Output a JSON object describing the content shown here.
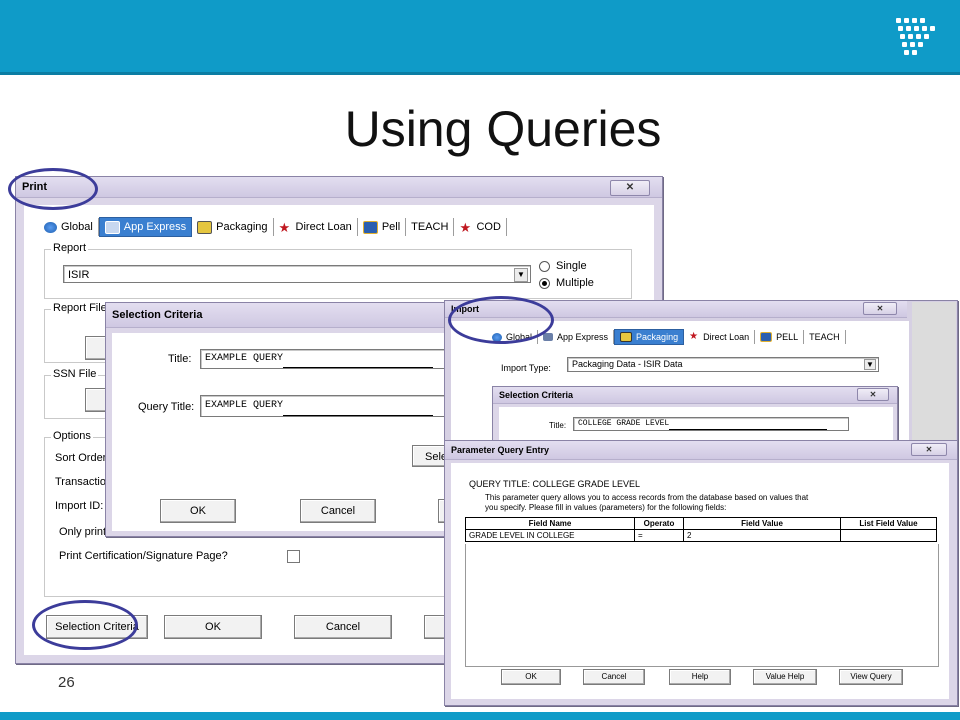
{
  "slide": {
    "title": "Using Queries",
    "page_number": "26"
  },
  "colors": {
    "banner": "#0f9bc8",
    "window_frame": "#dcd6e8",
    "tab_active": "#3a7fd0",
    "highlight_oval": "#3c3c9a"
  },
  "print_window": {
    "title": "Print",
    "close": "✕",
    "tabs": [
      {
        "label": "Global",
        "icon": "globe-icon"
      },
      {
        "label": "App Express",
        "icon": "app-express-icon"
      },
      {
        "label": "Packaging",
        "icon": "packaging-icon"
      },
      {
        "label": "Direct Loan",
        "icon": "star-icon"
      },
      {
        "label": "Pell",
        "icon": "pell-icon"
      },
      {
        "label": "TEACH",
        "icon": ""
      },
      {
        "label": "COD",
        "icon": "star-icon"
      }
    ],
    "report_group": "Report",
    "report_value": "ISIR",
    "single_label": "Single",
    "multiple_label": "Multiple",
    "report_file_group": "Report File",
    "ssn_file_group": "SSN File",
    "options_group": "Options",
    "sort_order_label": "Sort Order",
    "transaction_label": "Transactio",
    "import_id_label": "Import ID:",
    "only_print_label": "Only print",
    "print_cert_label": "Print Certification/Signature Page?",
    "buttons": {
      "selection_criteria": "Selection Criteria",
      "ok": "OK",
      "cancel": "Cancel"
    }
  },
  "selection_window": {
    "title": "Selection Criteria",
    "title_label": "Title:",
    "title_value": "EXAMPLE QUERY",
    "query_title_label": "Query Title:",
    "query_title_value": "EXAMPLE QUERY",
    "partial_button": "Sele",
    "ok": "OK",
    "cancel": "Cancel"
  },
  "import_window": {
    "title": "Import",
    "close": "✕",
    "tabs": [
      {
        "label": "Global",
        "icon": "globe-icon"
      },
      {
        "label": "App Express",
        "icon": "app-express-icon"
      },
      {
        "label": "Packaging",
        "icon": "packaging-icon"
      },
      {
        "label": "Direct Loan",
        "icon": "star-icon"
      },
      {
        "label": "PELL",
        "icon": "pell-icon"
      },
      {
        "label": "TEACH",
        "icon": ""
      }
    ],
    "import_type_label": "Import Type:",
    "import_type_value": "Packaging Data - ISIR Data"
  },
  "selection_small": {
    "title": "Selection Criteria",
    "close": "✕",
    "title_label": "Title:",
    "title_value": "COLLEGE GRADE LEVEL"
  },
  "param_window": {
    "title": "Parameter Query Entry",
    "close": "✕",
    "query_title": "QUERY TITLE: COLLEGE GRADE LEVEL",
    "description_line1": "This parameter query allows you to access records from the database based on values that",
    "description_line2": "you specify.  Please fill in values (parameters) for the following fields:",
    "columns": [
      "Field Name",
      "Operato",
      "Field Value",
      "List Field Value"
    ],
    "rows": [
      [
        "GRADE LEVEL IN COLLEGE",
        "=",
        "2",
        ""
      ]
    ],
    "buttons": [
      "OK",
      "Cancel",
      "Help",
      "Value Help",
      "View Query"
    ]
  }
}
